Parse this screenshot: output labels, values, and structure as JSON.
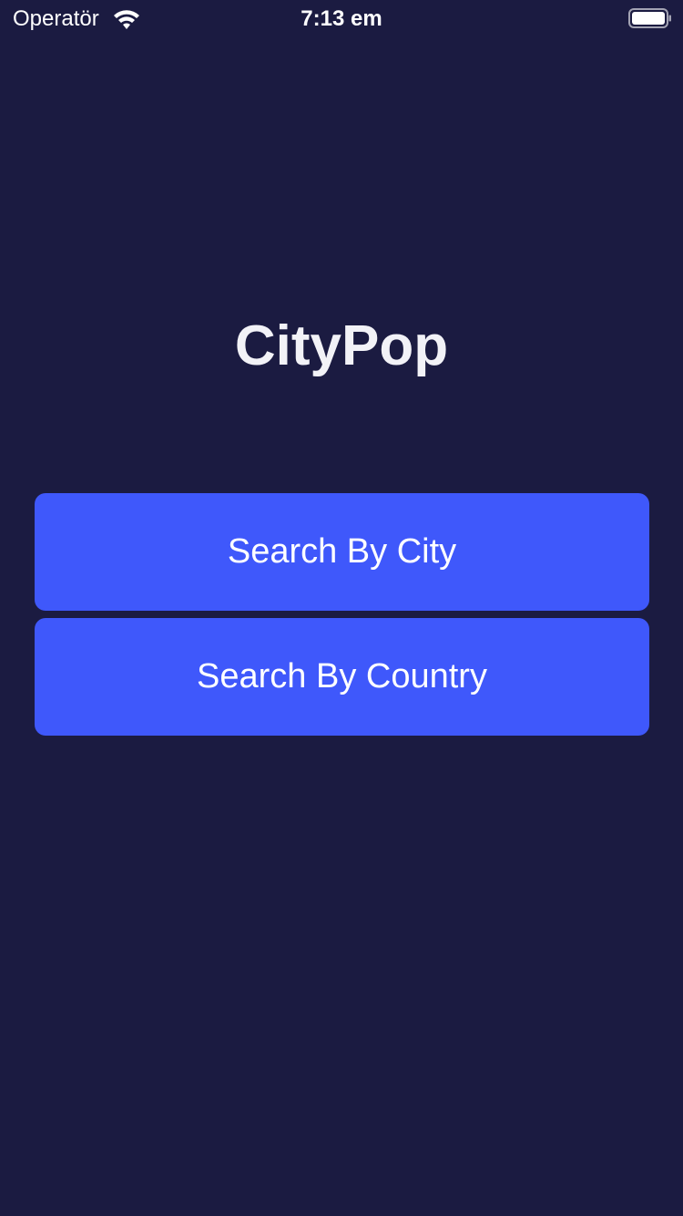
{
  "status_bar": {
    "carrier": "Operatör",
    "time": "7:13 em",
    "wifi_icon": "wifi-icon",
    "battery_icon": "battery-icon"
  },
  "app": {
    "title": "CityPop"
  },
  "actions": {
    "search_by_city_label": "Search By City",
    "search_by_country_label": "Search By Country"
  },
  "colors": {
    "background": "#1b1b41",
    "button": "#3f58fb",
    "text": "#ffffff"
  }
}
